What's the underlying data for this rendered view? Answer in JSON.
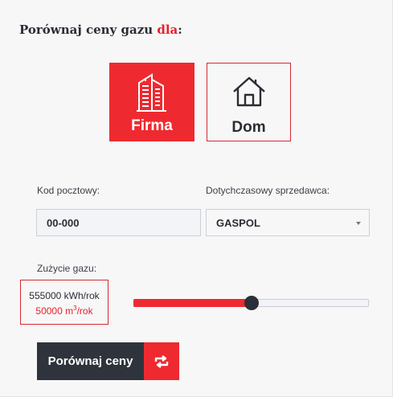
{
  "title": {
    "prefix": "Porównaj ceny gazu",
    "accent": "dla",
    "suffix": ":"
  },
  "customer_types": [
    {
      "label": "Firma",
      "icon": "building-icon",
      "selected": true
    },
    {
      "label": "Dom",
      "icon": "house-icon",
      "selected": false
    }
  ],
  "postal_code": {
    "label": "Kod pocztowy:",
    "value": "00-000"
  },
  "supplier": {
    "label": "Dotychczasowy sprzedawca:",
    "value": "GASPOL"
  },
  "usage": {
    "label": "Zużycie gazu:",
    "kwh": "555000 kWh/rok",
    "m3_value": "50000 m",
    "m3_sup": "3",
    "m3_suffix": "/rok",
    "slider_fraction": 0.5
  },
  "compare_button": {
    "label": "Porównaj ceny",
    "icon": "refresh-icon"
  },
  "colors": {
    "accent": "#ee2a30",
    "dark": "#2f343c"
  }
}
